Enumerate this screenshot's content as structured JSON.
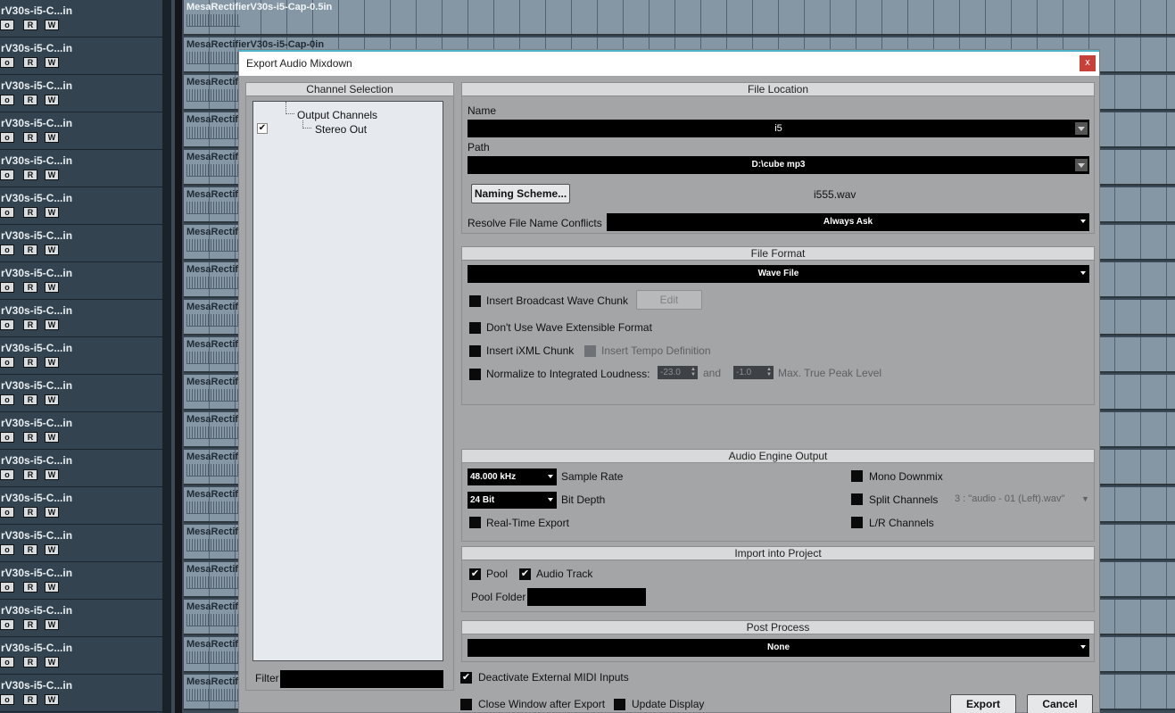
{
  "window_title": "Export Audio Mixdown",
  "close_label": "x",
  "daw": {
    "track_name": "rV30s-i5-C...in",
    "btn_o": "o",
    "btn_r": "R",
    "btn_w": "W",
    "lane_names": [
      "MesaRectifierV30s-i5-Cap-0.5in",
      "MesaRectifierV30s-i5-Cap-0in",
      "MesaRectif",
      "MesaRectif",
      "MesaRectif",
      "MesaRectif",
      "MesaRectif",
      "MesaRectif",
      "MesaRectif",
      "MesaRectif",
      "MesaRectif",
      "MesaRectif",
      "MesaRectif",
      "MesaRectif",
      "MesaRectif",
      "MesaRectif",
      "MesaRectif",
      "MesaRectif",
      "MesaRectif"
    ]
  },
  "channel_selection": {
    "header": "Channel Selection",
    "tree": {
      "root": "Output Channels",
      "child": "Stereo Out",
      "child_checked": "✔"
    },
    "filter_label": "Filter",
    "filter_value": ""
  },
  "file_location": {
    "header": "File Location",
    "name_label": "Name",
    "name_value": "i5",
    "path_label": "Path",
    "path_value": "D:\\cube mp3",
    "naming_scheme_button": "Naming Scheme...",
    "preview_filename": "i555.wav",
    "conflicts_label": "Resolve File Name Conflicts",
    "conflicts_value": "Always Ask"
  },
  "file_format": {
    "header": "File Format",
    "format_value": "Wave File",
    "broadcast_wave_label": "Insert Broadcast Wave Chunk",
    "edit_button": "Edit",
    "wave_extensible_label": "Don't Use Wave Extensible Format",
    "ixml_label": "Insert iXML Chunk",
    "tempo_label": "Insert Tempo Definition",
    "normalize_label": "Normalize to Integrated Loudness:",
    "loudness_value": "-23.0",
    "and_label": "and",
    "peak_value": "-1.0",
    "peak_label": "Max. True Peak Level"
  },
  "audio_engine": {
    "header": "Audio Engine Output",
    "sample_rate_value": "48.000 kHz",
    "sample_rate_label": "Sample Rate",
    "bit_depth_value": "24 Bit",
    "bit_depth_label": "Bit Depth",
    "realtime_label": "Real-Time Export",
    "mono_label": "Mono Downmix",
    "split_label": "Split Channels",
    "split_value": "3 : \"audio - 01 (Left).wav\"",
    "lr_label": "L/R Channels"
  },
  "import_project": {
    "header": "Import into Project",
    "pool_label": "Pool",
    "pool_checked": "✔",
    "audio_track_label": "Audio Track",
    "audio_track_checked": "✔",
    "pool_folder_label": "Pool Folder",
    "pool_folder_value": ""
  },
  "post_process": {
    "header": "Post Process",
    "value": "None"
  },
  "footer": {
    "deactivate_midi_label": "Deactivate External MIDI Inputs",
    "deactivate_midi_checked": "✔",
    "close_after_label": "Close Window after Export",
    "update_display_label": "Update Display",
    "export_button": "Export",
    "cancel_button": "Cancel"
  }
}
